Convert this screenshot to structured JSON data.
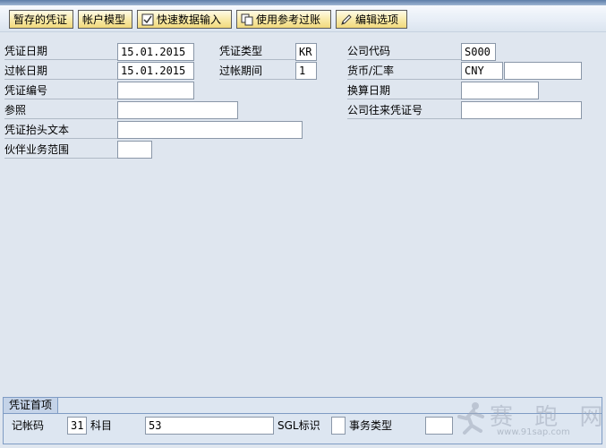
{
  "toolbar": {
    "parked_doc": "暂存的凭证",
    "account_model": "帐户模型",
    "fast_data_entry": "快速数据输入",
    "post_with_reference": "使用参考过账",
    "editing_options": "编辑选项"
  },
  "header": {
    "document_date": {
      "label": "凭证日期",
      "value": "15.01.2015"
    },
    "posting_date": {
      "label": "过帐日期",
      "value": "15.01.2015"
    },
    "document_number": {
      "label": "凭证编号",
      "value": ""
    },
    "reference": {
      "label": "参照",
      "value": ""
    },
    "header_text": {
      "label": "凭证抬头文本",
      "value": ""
    },
    "partner_business_area": {
      "label": "伙伴业务范围",
      "value": ""
    },
    "document_type": {
      "label": "凭证类型",
      "value": "KR"
    },
    "period": {
      "label": "过帐期间",
      "value": "1"
    },
    "company_code": {
      "label": "公司代码",
      "value": "S000"
    },
    "currency_rate": {
      "label": "货币/汇率",
      "currency": "CNY",
      "rate": ""
    },
    "translation_date": {
      "label": "换算日期",
      "value": ""
    },
    "intercompany_number": {
      "label": "公司往来凭证号",
      "value": ""
    }
  },
  "first_line_item": {
    "title": "凭证首项",
    "posting_key": {
      "label": "记帐码",
      "value": "31"
    },
    "account": {
      "label": "科目",
      "value": "53"
    },
    "sgl_indicator": {
      "label": "SGL标识",
      "value": ""
    },
    "transaction_type": {
      "label": "事务类型",
      "value": ""
    }
  },
  "watermark": {
    "text": "赛 跑 网",
    "url": "www.91sap.com"
  },
  "colors": {
    "button_fill": "#f8e9a6",
    "background": "#dfe6ef",
    "group_border": "#7f9cc4"
  }
}
